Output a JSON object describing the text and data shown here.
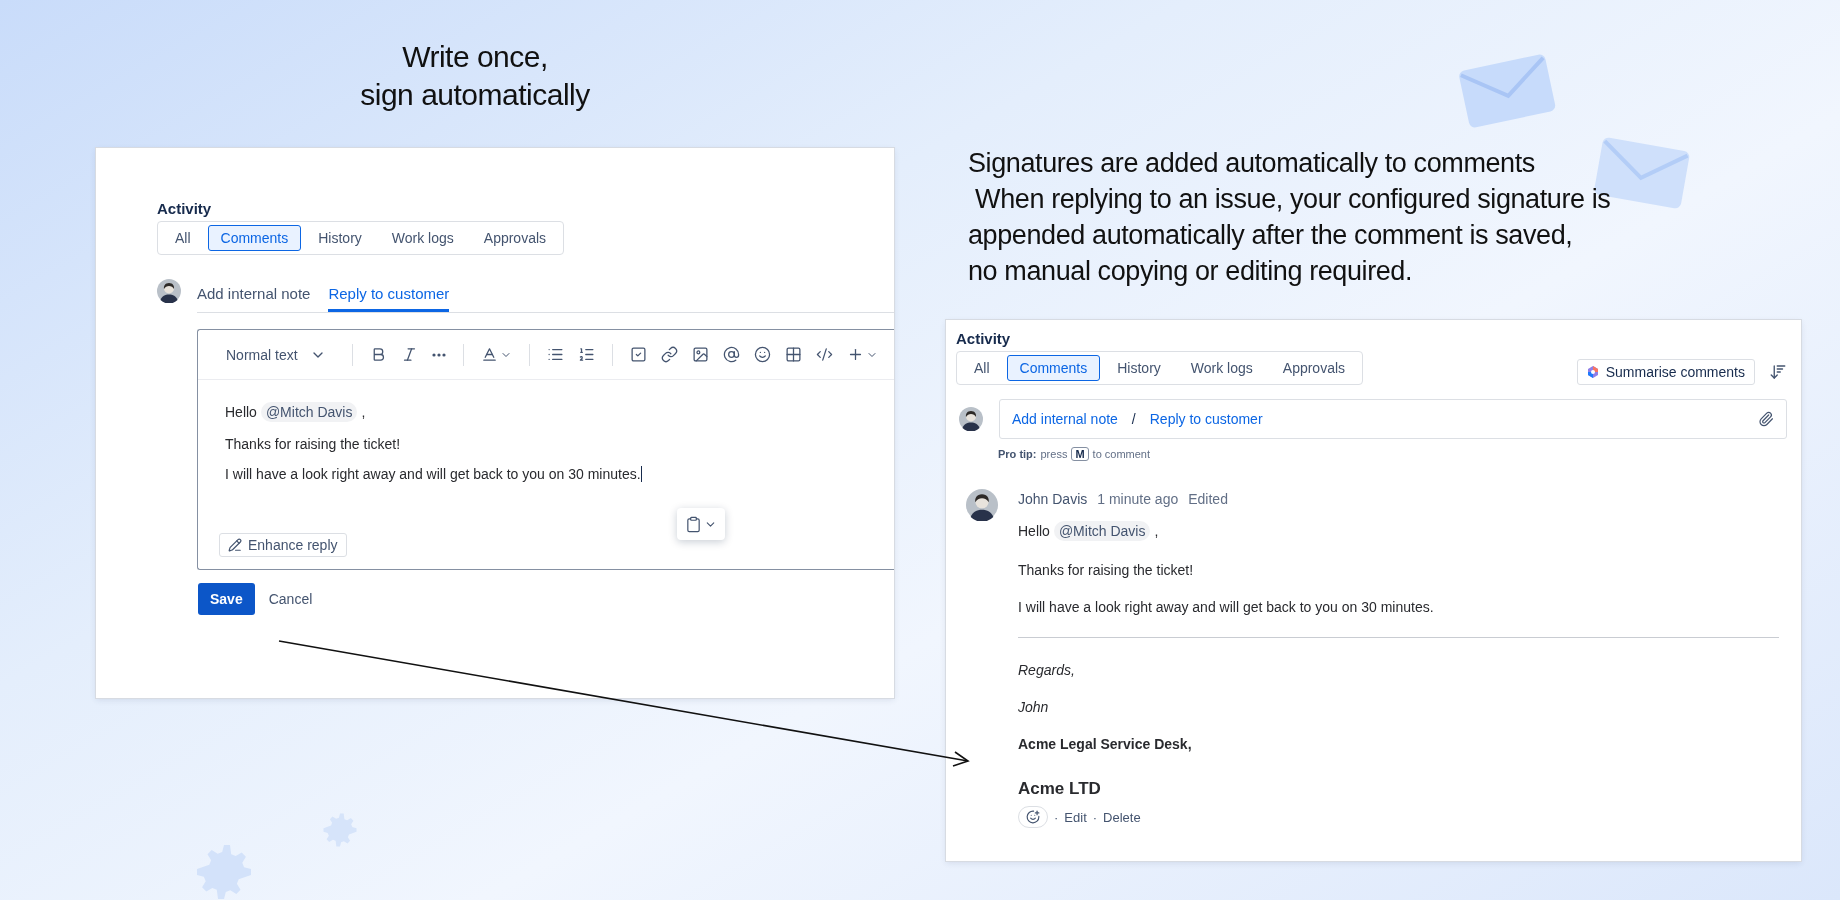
{
  "headline": "Write once,\nsign automatically",
  "description": {
    "title": "Signatures are added automatically to comments",
    "body": " When replying to an issue, your configured signature is\nappended automatically after the comment is saved,\nno manual copying or editing required."
  },
  "editor_view": {
    "section_title": "Activity",
    "filters": [
      {
        "label": "All",
        "selected": false
      },
      {
        "label": "Comments",
        "selected": true
      },
      {
        "label": "History",
        "selected": false
      },
      {
        "label": "Work logs",
        "selected": false
      },
      {
        "label": "Approvals",
        "selected": false
      }
    ],
    "compose_tabs": [
      {
        "label": "Add internal note",
        "selected": false
      },
      {
        "label": "Reply to customer",
        "selected": true
      }
    ],
    "text_style": "Normal text",
    "message": {
      "greeting": "Hello",
      "mention": "@Mitch Davis",
      "comma": ",",
      "lines": [
        "Thanks for raising the ticket!",
        "I will have a look right away and will get back to you on 30 minutes."
      ]
    },
    "enhance_button": "Enhance reply",
    "save_button": "Save",
    "cancel_button": "Cancel"
  },
  "comment_view": {
    "section_title": "Activity",
    "filters": [
      {
        "label": "All",
        "selected": false
      },
      {
        "label": "Comments",
        "selected": true
      },
      {
        "label": "History",
        "selected": false
      },
      {
        "label": "Work logs",
        "selected": false
      },
      {
        "label": "Approvals",
        "selected": false
      }
    ],
    "summarise_button": "Summarise comments",
    "compose": {
      "links": [
        "Add internal note",
        "Reply to customer"
      ],
      "separator": "/"
    },
    "pro_tip": {
      "label": "Pro tip:",
      "before": "press",
      "key": "M",
      "after": "to comment"
    },
    "comment": {
      "author": "John Davis",
      "time": "1 minute ago",
      "status": "Edited",
      "greeting": "Hello",
      "mention": "@Mitch Davis",
      "comma": ",",
      "lines": [
        "Thanks for raising the ticket!",
        "I will have a look right away and will get back to you on 30 minutes."
      ],
      "signature": [
        {
          "kind": "italic",
          "text": "Regards,"
        },
        {
          "kind": "italic",
          "text": "John"
        },
        {
          "kind": "bold",
          "text": "Acme Legal Service Desk,"
        },
        {
          "kind": "heading",
          "text": "Acme LTD"
        }
      ],
      "action_separator": "·",
      "actions": [
        "Edit",
        "Delete"
      ]
    }
  }
}
